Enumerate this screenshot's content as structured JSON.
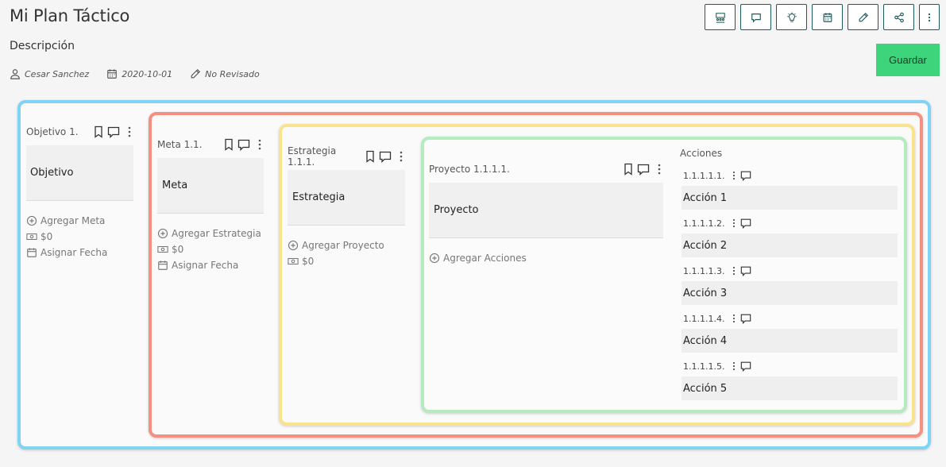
{
  "header": {
    "title": "Mi Plan Táctico",
    "description": "Descripción",
    "author": "Cesar Sanchez",
    "date": "2020-10-01",
    "review_status": "No Revisado",
    "save_label": "Guardar"
  },
  "toolbar": {
    "buttons": [
      "team-icon",
      "comment-icon",
      "idea-icon",
      "calendar-icon",
      "pencil-icon",
      "share-icon",
      "more-vertical-icon"
    ]
  },
  "colors": {
    "objetivo_border": "#7fd3f4",
    "meta_border": "#f3907f",
    "estrategia_border": "#f9e38e",
    "proyecto_border": "#b4ecc0",
    "save_button": "#3dd47b",
    "toolbar_border": "#1f5b5b"
  },
  "objetivo": {
    "label": "Objetivo 1.",
    "card": "Objetivo",
    "add_label": "Agregar Meta",
    "amount": "$0",
    "date_label": "Asignar Fecha"
  },
  "meta": {
    "label": "Meta 1.1.",
    "card": "Meta",
    "add_label": "Agregar Estrategia",
    "amount": "$0",
    "date_label": "Asignar Fecha"
  },
  "estrategia": {
    "label": "Estrategia 1.1.1.",
    "card": "Estrategia",
    "add_label": "Agregar Proyecto",
    "amount": "$0"
  },
  "proyecto": {
    "label": "Proyecto 1.1.1.1.",
    "card": "Proyecto",
    "add_label": "Agregar Acciones"
  },
  "acciones": {
    "title": "Acciones",
    "items": [
      {
        "number": "1.1.1.1.1.",
        "label": "Acción 1"
      },
      {
        "number": "1.1.1.1.2.",
        "label": "Acción 2"
      },
      {
        "number": "1.1.1.1.3.",
        "label": "Acción 3"
      },
      {
        "number": "1.1.1.1.4.",
        "label": "Acción 4"
      },
      {
        "number": "1.1.1.1.5.",
        "label": "Acción 5"
      }
    ]
  }
}
